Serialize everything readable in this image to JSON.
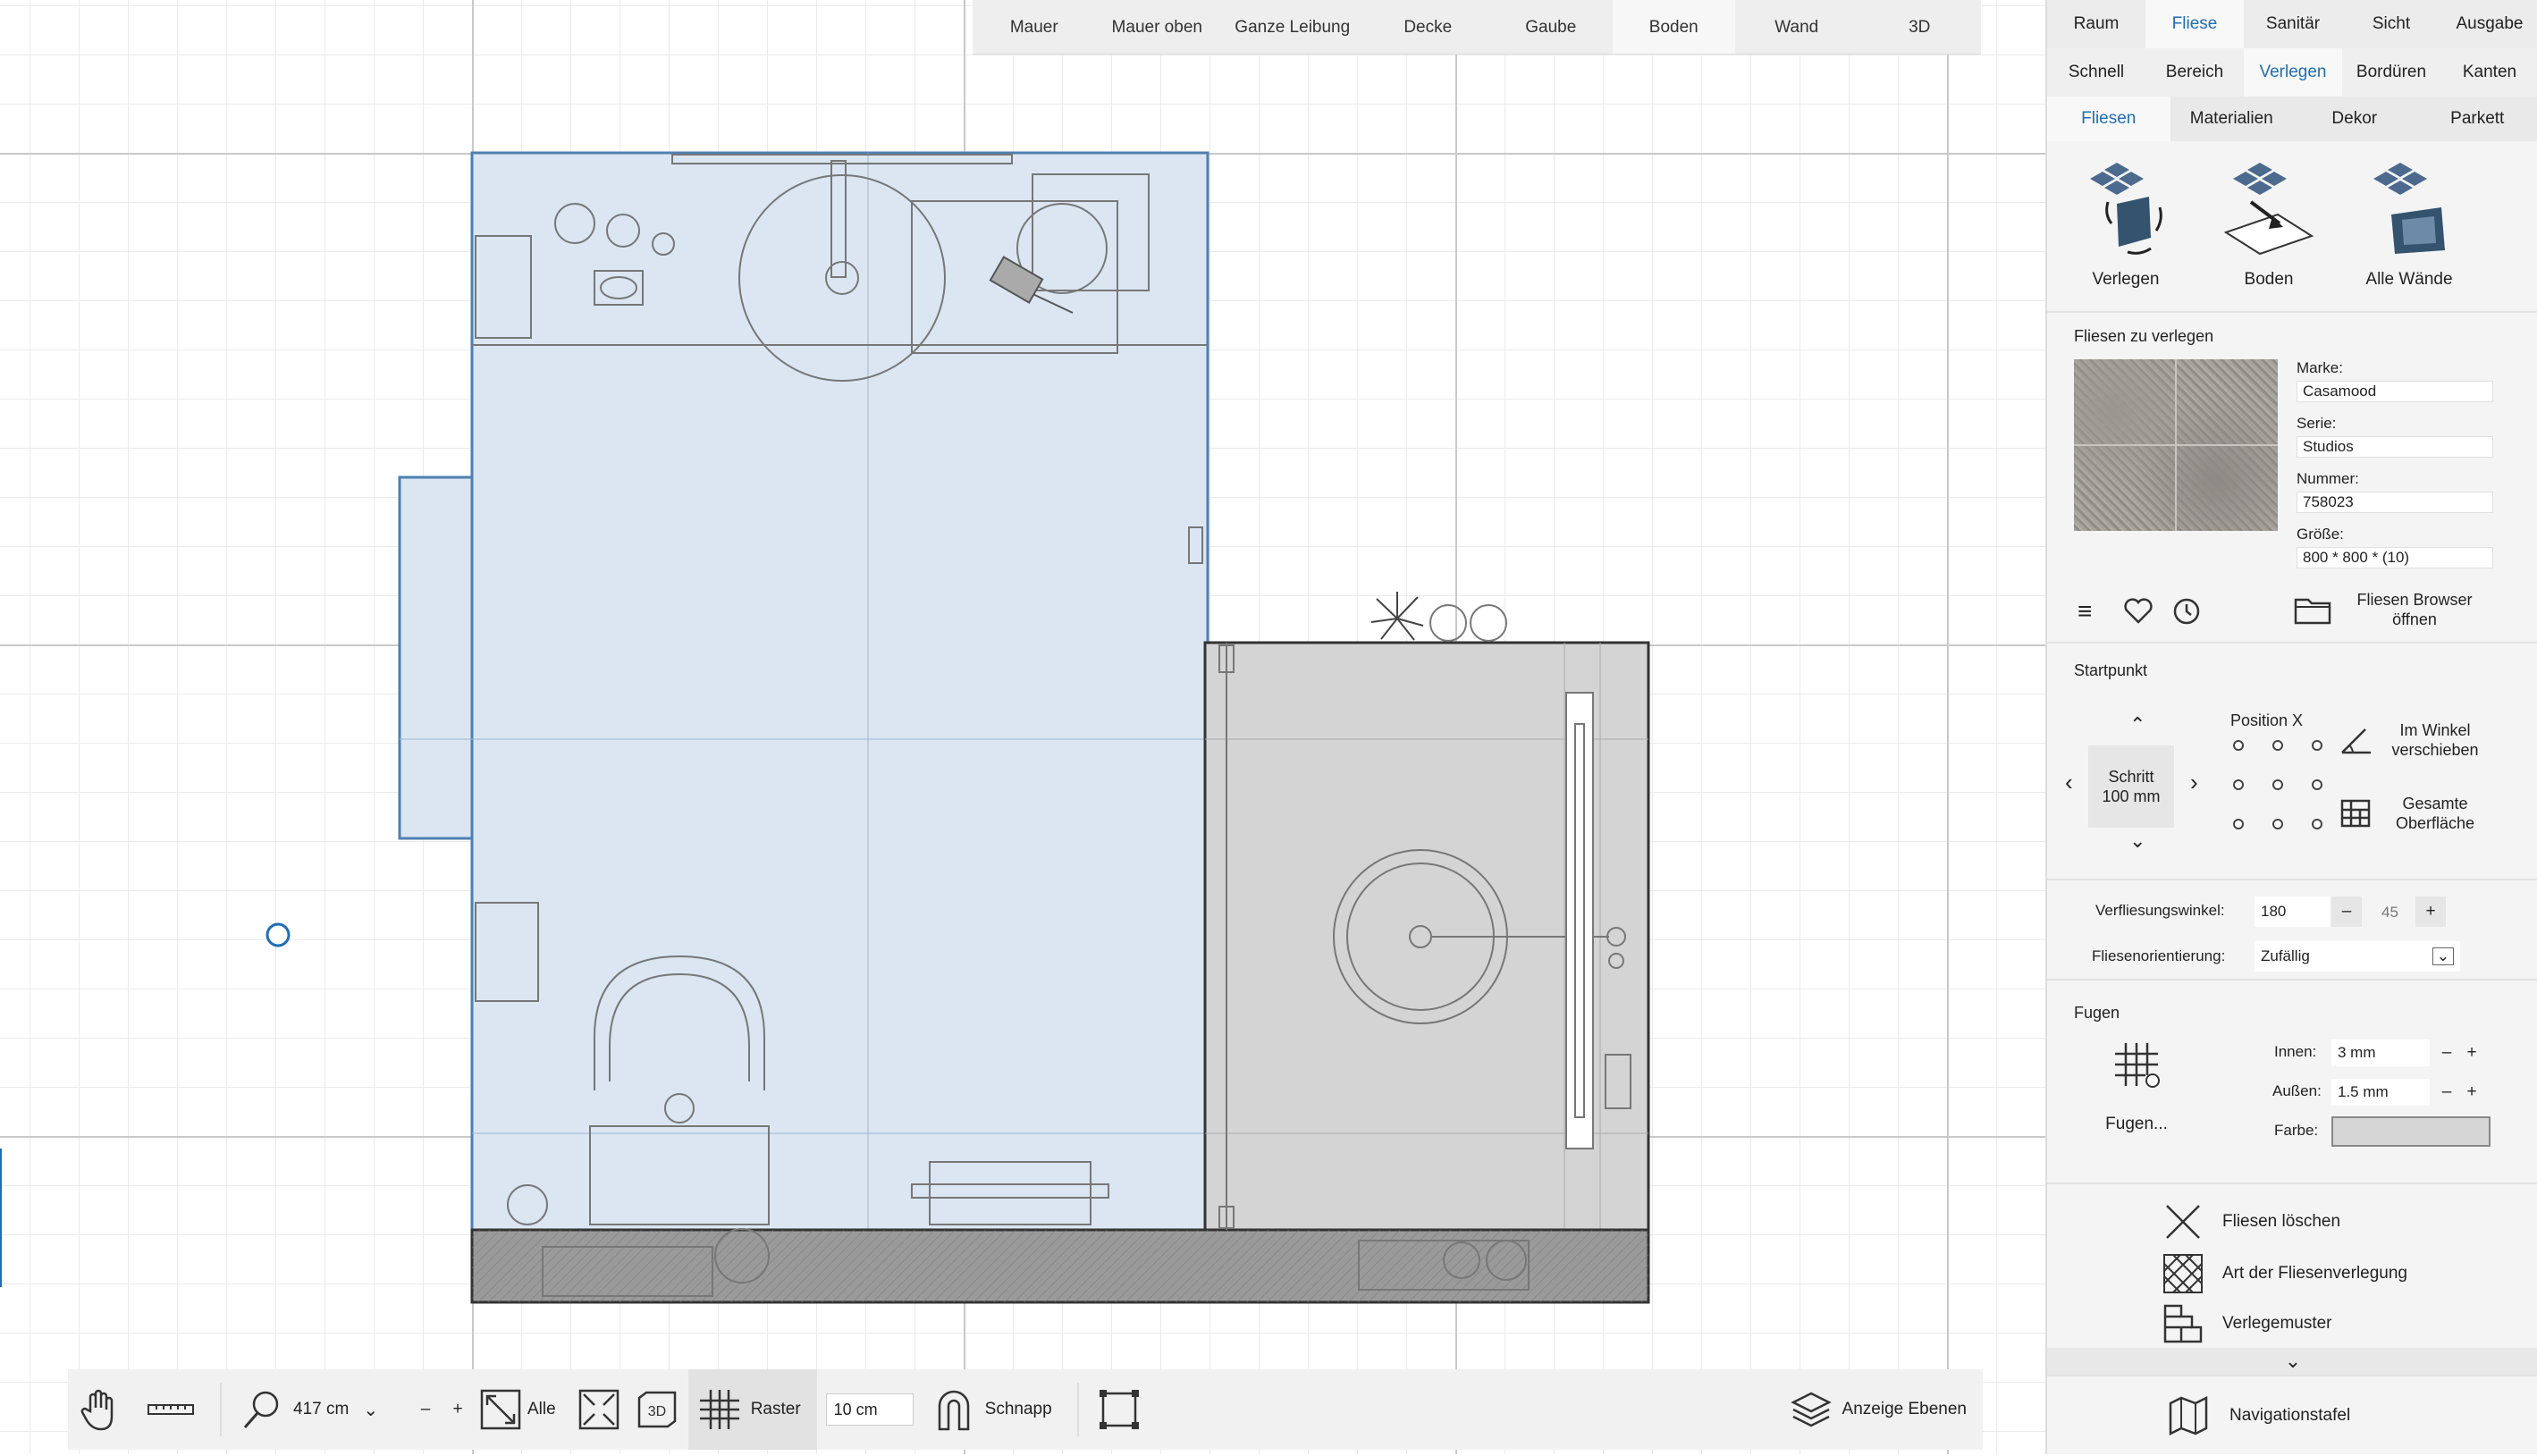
{
  "view_tabs": [
    "Mauer",
    "Mauer oben",
    "Ganze Leibung",
    "Decke",
    "Gaube",
    "Boden",
    "Wand",
    "3D"
  ],
  "view_tab_active": "Boden",
  "toolbar": {
    "zoom_value": "417 cm",
    "zoom_minus": "–",
    "zoom_plus": "+",
    "fit_all_label": "Alle",
    "grid_label": "Raster",
    "grid_size": "10 cm",
    "snap_label": "Schnapp",
    "layers_label": "Anzeige Ebenen"
  },
  "panel": {
    "main_tabs": [
      "Raum",
      "Fliese",
      "Sanitär",
      "Sicht",
      "Ausgabe"
    ],
    "main_tab_active": "Fliese",
    "sub_tabs": [
      "Schnell",
      "Bereich",
      "Verlegen",
      "Bordüren",
      "Kanten"
    ],
    "sub_tab_active": "Verlegen",
    "material_tabs": [
      "Fliesen",
      "Materialien",
      "Dekor",
      "Parkett"
    ],
    "material_tab_active": "Fliesen",
    "actions": [
      "Verlegen",
      "Boden",
      "Alle Wände"
    ],
    "tiles_heading": "Fliesen zu verlegen",
    "brand_label": "Marke:",
    "brand_value": "Casamood",
    "series_label": "Serie:",
    "series_value": "Studios",
    "number_label": "Nummer:",
    "number_value": "758023",
    "size_label": "Größe:",
    "size_value": "800 * 800 * (10)",
    "browser_button": "Fliesen Browser öffnen",
    "start_heading": "Startpunkt",
    "step_label": "Schritt",
    "step_value": "100 mm",
    "position_label": "Position X",
    "rotate_label": "Im Winkel verschieben",
    "surface_label": "Gesamte Oberfläche",
    "angle_label": "Verfliesungswinkel:",
    "angle_value": "180",
    "angle_step": "45",
    "orientation_label": "Fliesenorientierung:",
    "orientation_value": "Zufällig",
    "joints_heading": "Fugen",
    "joints_button": "Fugen...",
    "inner_label": "Innen:",
    "inner_value": "3 mm",
    "outer_label": "Außen:",
    "outer_value": "1.5 mm",
    "color_label": "Farbe:",
    "color_value": "#d6d6d6",
    "delete_label": "Fliesen löschen",
    "type_label": "Art der Fliesenverlegung",
    "pattern_label": "Verlegemuster",
    "nav_label": "Navigationstafel"
  },
  "colors": {
    "accent": "#1f6db5",
    "floor_selected": "#dbe6f2",
    "floor_other": "#d4d4d4"
  }
}
